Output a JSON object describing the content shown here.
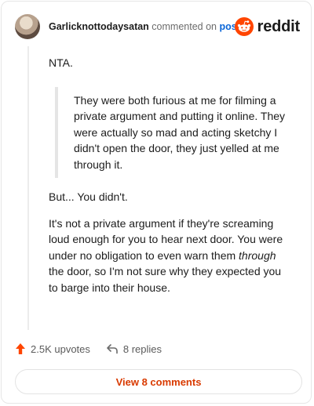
{
  "header": {
    "username": "Garlicknottodaysatan",
    "action": " commented on ",
    "link": "post",
    "brand": "reddit"
  },
  "comment": {
    "p1": "NTA.",
    "quote": "They were both furious at me for filming a private argument and putting it online. They were actually so mad and acting sketchy I didn't open the door, they just yelled at me through it.",
    "p2": "But... You didn't.",
    "p3_a": "It's not a private argument if they're screaming loud enough for you to hear next door. You were under no obligation to even warn them ",
    "p3_em": "through",
    "p3_b": " the door, so I'm not sure why they expected you to barge into their house."
  },
  "actions": {
    "upvotes": "2.5K upvotes",
    "replies": "8 replies",
    "view_comments": "View 8 comments"
  },
  "colors": {
    "accent": "#ff4500",
    "link": "#0a66d8",
    "button_text": "#d93a00"
  },
  "icons": [
    "avatar",
    "reddit-logo-icon",
    "upvote-arrow-icon",
    "reply-arrow-icon"
  ]
}
